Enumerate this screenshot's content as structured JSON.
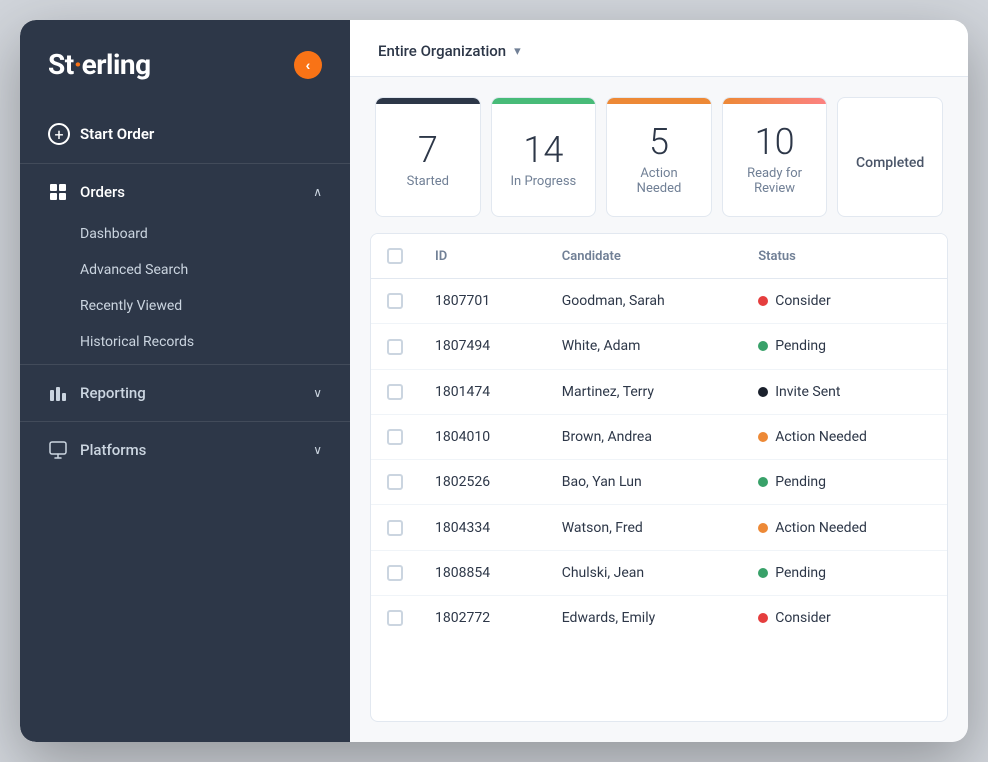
{
  "window": {
    "title": "Sterling"
  },
  "sidebar": {
    "logo": "Sterling",
    "collapse_button_label": "‹",
    "start_order_label": "Start Order",
    "nav_items": [
      {
        "id": "orders",
        "label": "Orders",
        "icon": "grid-icon",
        "expanded": true,
        "sub_items": [
          {
            "id": "dashboard",
            "label": "Dashboard"
          },
          {
            "id": "advanced-search",
            "label": "Advanced Search"
          },
          {
            "id": "recently-viewed",
            "label": "Recently Viewed"
          },
          {
            "id": "historical-records",
            "label": "Historical Records"
          }
        ]
      },
      {
        "id": "reporting",
        "label": "Reporting",
        "icon": "chart-icon",
        "expanded": false,
        "sub_items": []
      },
      {
        "id": "platforms",
        "label": "Platforms",
        "icon": "platforms-icon",
        "expanded": false,
        "sub_items": []
      }
    ]
  },
  "header": {
    "org_selector_label": "Entire Organization",
    "org_selector_chevron": "▾"
  },
  "stats": [
    {
      "id": "started",
      "number": "7",
      "label": "Started",
      "bar_class": "bar-dark"
    },
    {
      "id": "in-progress",
      "number": "14",
      "label": "In Progress",
      "bar_class": "bar-green"
    },
    {
      "id": "action-needed",
      "number": "5",
      "label": "Action Needed",
      "bar_class": "bar-orange"
    },
    {
      "id": "ready-for-review",
      "number": "10",
      "label": "Ready for Review",
      "bar_class": "bar-red"
    },
    {
      "id": "completed",
      "number": "",
      "label": "Completed",
      "bar_class": "bar-none"
    }
  ],
  "table": {
    "columns": [
      "",
      "ID",
      "Candidate",
      "Status"
    ],
    "rows": [
      {
        "id": "1807701",
        "candidate": "Goodman, Sarah",
        "status": "Consider",
        "dot_class": "dot-red"
      },
      {
        "id": "1807494",
        "candidate": "White, Adam",
        "status": "Pending",
        "dot_class": "dot-green"
      },
      {
        "id": "1801474",
        "candidate": "Martinez, Terry",
        "status": "Invite Sent",
        "dot_class": "dot-black"
      },
      {
        "id": "1804010",
        "candidate": "Brown, Andrea",
        "status": "Action Needed",
        "dot_class": "dot-orange"
      },
      {
        "id": "1802526",
        "candidate": "Bao, Yan Lun",
        "status": "Pending",
        "dot_class": "dot-green"
      },
      {
        "id": "1804334",
        "candidate": "Watson, Fred",
        "status": "Action Needed",
        "dot_class": "dot-orange"
      },
      {
        "id": "1808854",
        "candidate": "Chulski, Jean",
        "status": "Pending",
        "dot_class": "dot-green"
      },
      {
        "id": "1802772",
        "candidate": "Edwards, Emily",
        "status": "Consider",
        "dot_class": "dot-red"
      }
    ]
  }
}
